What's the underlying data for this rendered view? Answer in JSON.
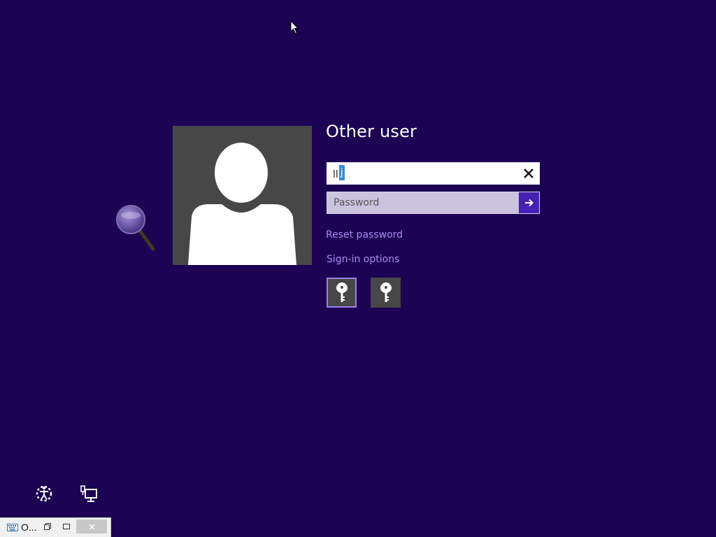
{
  "login": {
    "user_name": "Other user",
    "username_prefix": "ll",
    "username_selected": "j",
    "password_placeholder": "Password",
    "reset_password": "Reset password",
    "signin_options": "Sign-in options"
  },
  "signin_option_icons": [
    "password-key-icon",
    "password-key-icon"
  ],
  "bottom_icons": [
    "ease-of-access-icon",
    "network-icon"
  ],
  "osk_window": {
    "title": "O..."
  },
  "colors": {
    "background": "#1c0354",
    "accent": "#4521b3",
    "link": "#a78cf0",
    "tile": "#474747"
  }
}
